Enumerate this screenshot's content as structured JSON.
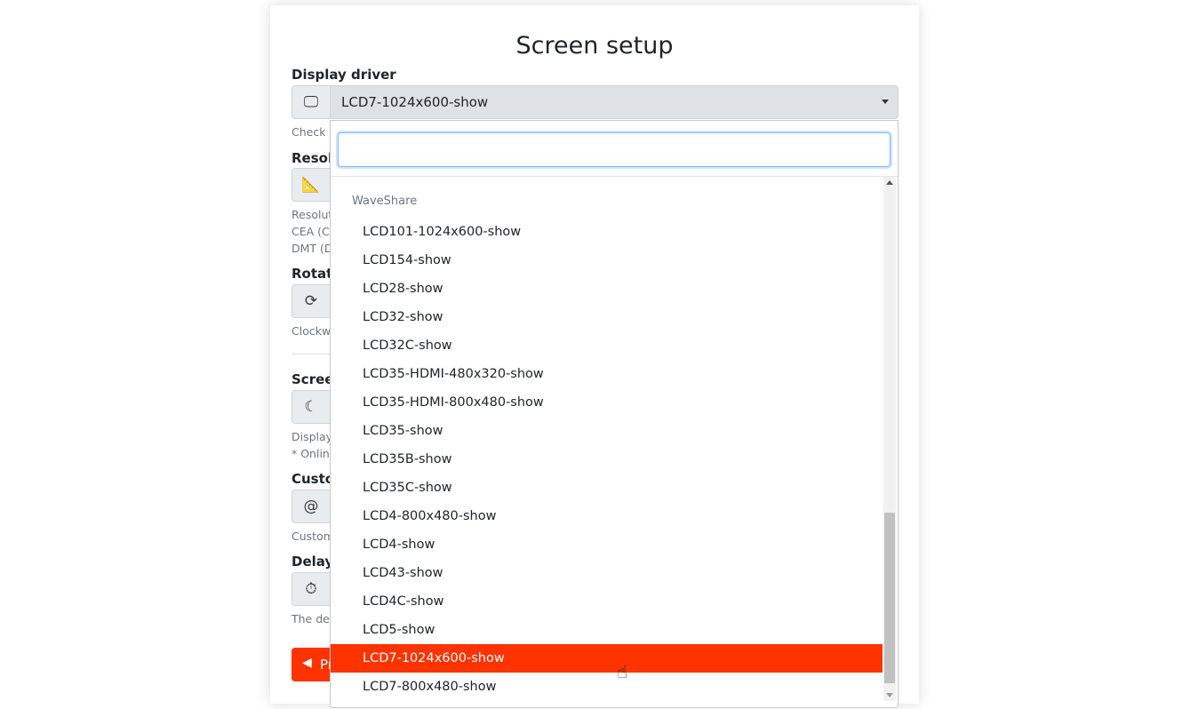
{
  "page": {
    "title": "Screen setup"
  },
  "form": {
    "display_driver": {
      "label": "Display driver",
      "value": "LCD7-1024x600-show",
      "help": "Check y"
    },
    "resolution": {
      "label": "Resolu",
      "help": [
        "Resoluti",
        "CEA (Co",
        "DMT (D"
      ]
    },
    "rotation": {
      "label": "Rotati",
      "help": "Clockwi"
    },
    "screensaver": {
      "label": "Screen",
      "help": [
        "Displaye",
        "* Online"
      ]
    },
    "custom": {
      "label": "Custo",
      "help": "Custom"
    },
    "delay": {
      "label": "Delay",
      "help": "The dela"
    },
    "prev_button": "Pr"
  },
  "dropdown": {
    "search_value": "",
    "group": "WaveShare",
    "items": [
      "LCD101-1024x600-show",
      "LCD154-show",
      "LCD28-show",
      "LCD32-show",
      "LCD32C-show",
      "LCD35-HDMI-480x320-show",
      "LCD35-HDMI-800x480-show",
      "LCD35-show",
      "LCD35B-show",
      "LCD35C-show",
      "LCD4-800x480-show",
      "LCD4-show",
      "LCD43-show",
      "LCD4C-show",
      "LCD5-show",
      "LCD7-1024x600-show",
      "LCD7-800x480-show"
    ],
    "selected": "LCD7-1024x600-show"
  },
  "colors": {
    "accent": "#ff3300",
    "focus": "#80bdff"
  }
}
